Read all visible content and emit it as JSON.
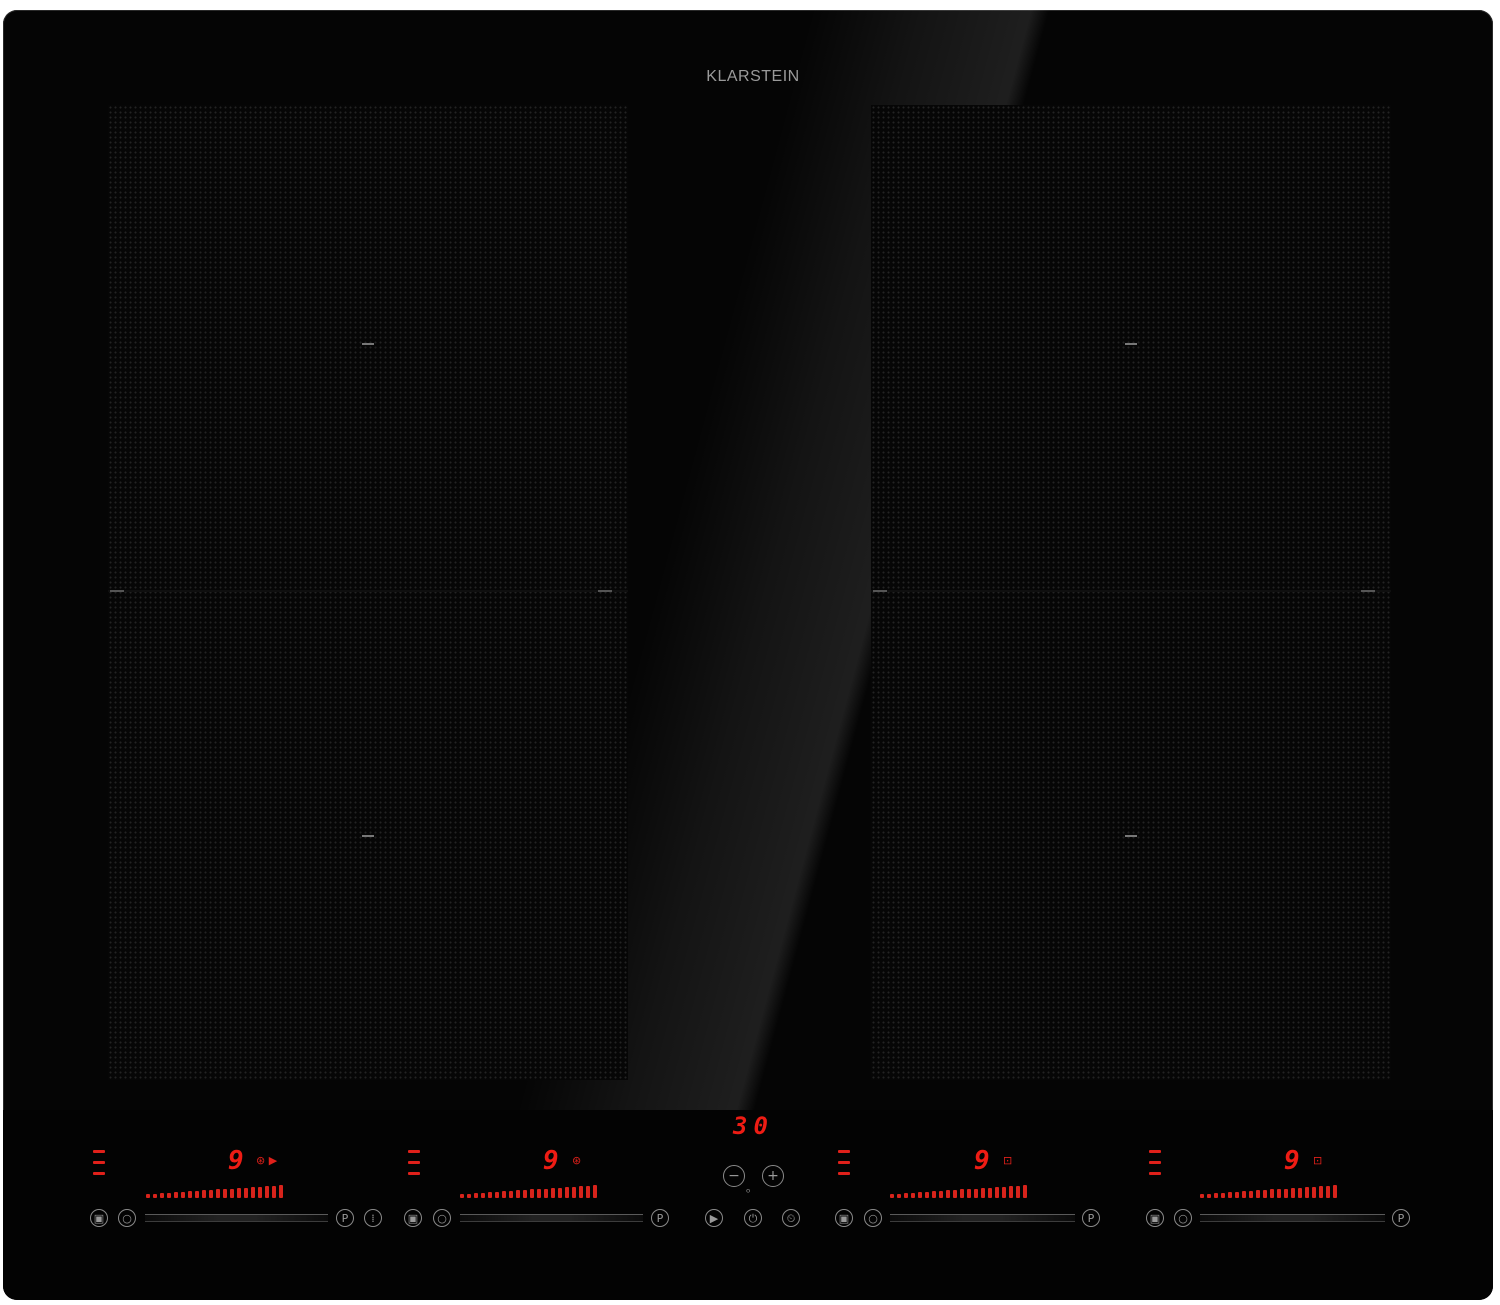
{
  "brand": "KLARSTEIN",
  "timer_display": "30",
  "zones": [
    {
      "level": "9",
      "icon": "boost-icon"
    },
    {
      "level": "9",
      "icon": "boost-icon"
    },
    {
      "level": "9",
      "icon": "boost-icon"
    },
    {
      "level": "9",
      "icon": "boost-icon"
    }
  ],
  "center_controls": {
    "minus_label": "−",
    "plus_label": "+",
    "pause_label": "▶",
    "lock_label": "⏻",
    "timer_label": "⏲"
  },
  "zone_buttons": {
    "flex_label": "▣",
    "on_label": "○",
    "preset_label": "P"
  },
  "colors": {
    "glass": "#050505",
    "display_red": "#e0201a",
    "button_grey": "#8a8a8a"
  }
}
